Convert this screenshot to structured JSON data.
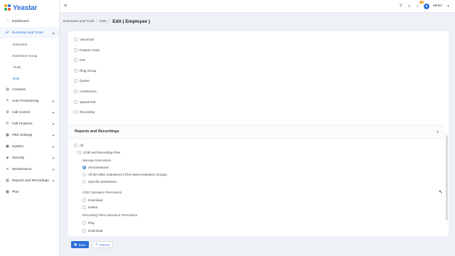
{
  "brand": {
    "name": "Yeastar"
  },
  "header": {
    "username": "admin",
    "notification_count": "13"
  },
  "sidebar": {
    "items": [
      {
        "label": "Dashboard",
        "icon": "dashboard-icon"
      },
      {
        "label": "Extension and Trunk",
        "icon": "extension-icon",
        "expanded": true
      },
      {
        "label": "Contacts",
        "icon": "contacts-icon"
      },
      {
        "label": "Auto Provisioning",
        "icon": "provisioning-icon"
      },
      {
        "label": "Call Control",
        "icon": "call-control-icon"
      },
      {
        "label": "Call Features",
        "icon": "call-features-icon"
      },
      {
        "label": "PBX Settings",
        "icon": "pbx-settings-icon"
      },
      {
        "label": "System",
        "icon": "system-icon"
      },
      {
        "label": "Security",
        "icon": "security-icon"
      },
      {
        "label": "Maintenance",
        "icon": "maintenance-icon"
      },
      {
        "label": "Reports and Recordings",
        "icon": "reports-icon"
      },
      {
        "label": "Plan",
        "icon": "plan-icon"
      }
    ],
    "sub_items": [
      "Extension",
      "Extension Group",
      "Trunk",
      "Role"
    ]
  },
  "breadcrumb": {
    "level1": "Extension and Trunk",
    "level2": "Role",
    "current": "Edit ( Employee )"
  },
  "permissions_list": [
    "Voicemail",
    "Feature Code",
    "IVR",
    "Ring Group",
    "Queue",
    "Conference",
    "Speed Dial",
    "Recording"
  ],
  "reports": {
    "title": "Reports and Recordings",
    "all_label": "All",
    "cdr_label": "CDR and Recording Files",
    "manage_ext_label": "Manage Extensions",
    "manage_options": [
      "All Extensions",
      "All the other extensions of the same Extension Groups",
      "Specific Extensions"
    ],
    "cdr_op_label": "CDR Operation Permission",
    "cdr_op_options": [
      "Download",
      "Delete"
    ],
    "rec_op_label": "Recording Files Operation Permission",
    "rec_op_options": [
      "Play",
      "Download"
    ]
  },
  "footer": {
    "save_label": "Save",
    "cancel_label": "Cancel"
  }
}
